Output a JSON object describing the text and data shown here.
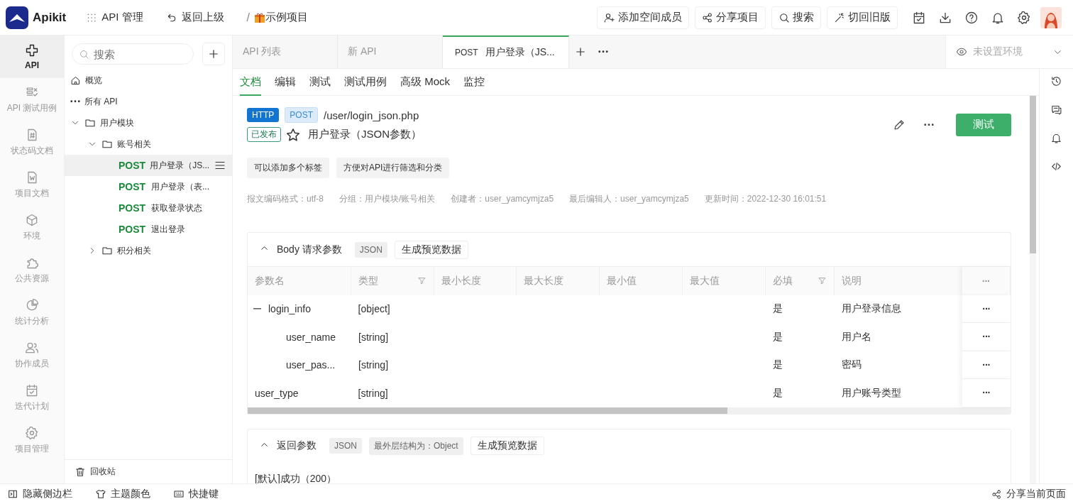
{
  "topbar": {
    "logo": "Apikit",
    "menu": "API 管理",
    "back": "返回上级",
    "separator": "/",
    "project": "示例项目",
    "buttons": [
      "添加空间成员",
      "分享项目",
      "搜索",
      "切回旧版"
    ]
  },
  "rail": [
    {
      "label": "API",
      "selected": true
    },
    {
      "label": "API 测试用例",
      "selected": false
    },
    {
      "label": "状态码文档",
      "selected": false
    },
    {
      "label": "项目文档",
      "selected": false
    },
    {
      "label": "环境",
      "selected": false
    },
    {
      "label": "公共资源",
      "selected": false
    },
    {
      "label": "统计分析",
      "selected": false
    },
    {
      "label": "协作成员",
      "selected": false
    },
    {
      "label": "迭代计划",
      "selected": false
    },
    {
      "label": "项目管理",
      "selected": false
    }
  ],
  "tree": {
    "search_placeholder": "搜索",
    "nodes": [
      {
        "kind": "home",
        "label": "概览"
      },
      {
        "kind": "all",
        "label": "所有 API"
      },
      {
        "kind": "folder",
        "label": "用户模块",
        "expanded": true,
        "children": [
          {
            "kind": "folder",
            "label": "账号相关",
            "expanded": true,
            "children": [
              {
                "kind": "api",
                "method": "POST",
                "label": "用户登录（JS...",
                "selected": true
              },
              {
                "kind": "api",
                "method": "POST",
                "label": "用户登录（表...",
                "selected": false
              },
              {
                "kind": "api",
                "method": "POST",
                "label": "获取登录状态",
                "selected": false
              },
              {
                "kind": "api",
                "method": "POST",
                "label": "退出登录",
                "selected": false
              }
            ]
          },
          {
            "kind": "folder",
            "label": "积分相关",
            "expanded": false
          }
        ]
      }
    ],
    "trash": "回收站"
  },
  "tabs": [
    {
      "label": "API 列表",
      "selected": false
    },
    {
      "label": "新 API",
      "selected": false
    },
    {
      "method": "POST",
      "label": "用户登录（JS...",
      "selected": true
    }
  ],
  "environment": {
    "placeholder": "未设置环境"
  },
  "subtabs": [
    {
      "label": "文档",
      "selected": true
    },
    {
      "label": "编辑",
      "selected": false
    },
    {
      "label": "测试",
      "selected": false
    },
    {
      "label": "测试用例",
      "selected": false
    },
    {
      "label": "高级 Mock",
      "selected": false
    },
    {
      "label": "监控",
      "selected": false
    }
  ],
  "api": {
    "protocol": "HTTP",
    "method": "POST",
    "path": "/user/login_json.php",
    "status": "已发布",
    "starred": false,
    "name": "用户登录（JSON参数）",
    "test_button": "测试",
    "tags": [
      "可以添加多个标签",
      "方便对API进行筛选和分类"
    ],
    "meta": [
      "报文编码格式：utf-8",
      "分组：用户模块/账号相关",
      "创建者：user_yamcymjza5",
      "最后编辑人：user_yamcymjza5",
      "更新时间：2022-12-30 16:01:51"
    ]
  },
  "body_params": {
    "expanded": true,
    "title": "Body 请求参数",
    "format": "JSON",
    "preview_button": "生成预览数据",
    "columns": [
      {
        "label": "参数名",
        "filter": false
      },
      {
        "label": "类型",
        "filter": true
      },
      {
        "label": "最小长度",
        "filter": false
      },
      {
        "label": "最大长度",
        "filter": false
      },
      {
        "label": "最小值",
        "filter": false
      },
      {
        "label": "最大值",
        "filter": false
      },
      {
        "label": "必填",
        "filter": true
      },
      {
        "label": "说明",
        "filter": false
      }
    ],
    "actions": "···",
    "rows": [
      {
        "name": "login_info",
        "type": "[object]",
        "required": "是",
        "description": "用户登录信息",
        "expanded": true,
        "children": [
          {
            "name": "user_name",
            "type": "[string]",
            "required": "是",
            "description": "用户名"
          },
          {
            "name": "user_pas...",
            "type": "[string]",
            "required": "是",
            "description": "密码"
          }
        ]
      },
      {
        "name": "user_type",
        "type": "[string]",
        "required": "是",
        "description": "用户账号类型"
      }
    ]
  },
  "response": {
    "expanded": true,
    "title": "返回参数",
    "format": "JSON",
    "structure": "最外层结构为：Object",
    "preview_button": "生成预览数据",
    "first_result": "[默认]成功（200）"
  },
  "bottombar": {
    "items": [
      "隐藏侧边栏",
      "主题颜色",
      "快捷键"
    ],
    "share": "分享当前页面"
  }
}
